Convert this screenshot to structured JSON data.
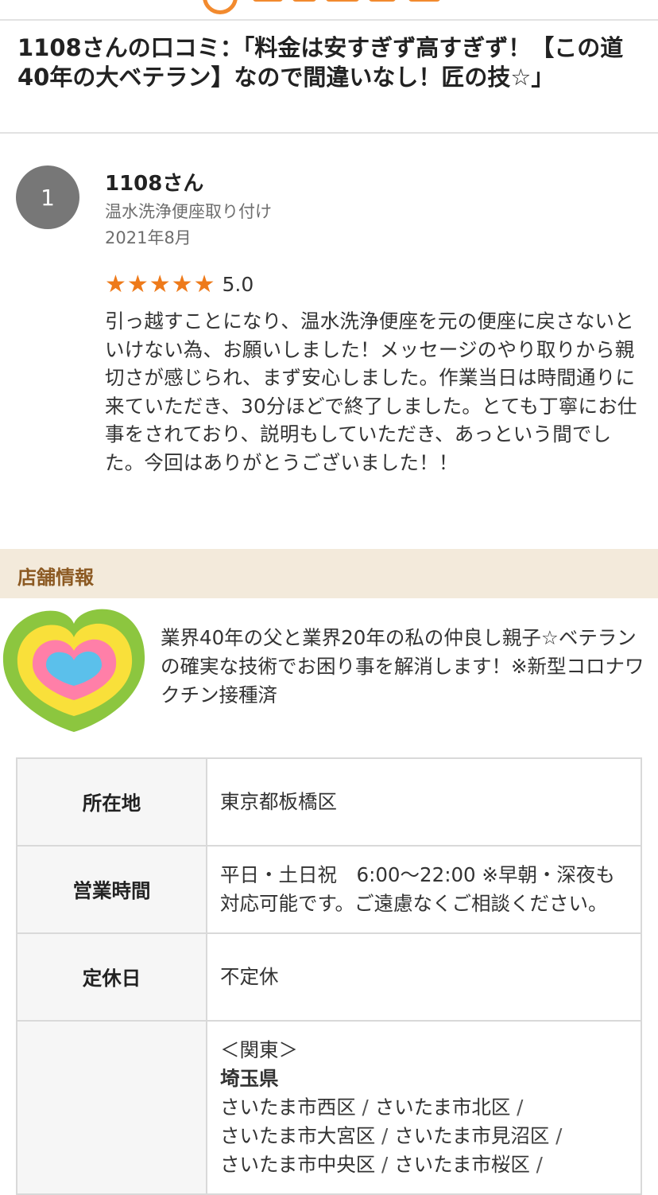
{
  "header": {
    "title": "1108さんの口コミ：「料金は安すぎず高すぎず！【この道40年の大ベテラン】なので間違いなし！匠の技☆」"
  },
  "review": {
    "avatar_text": "1",
    "username": "1108さん",
    "service": "温水洗浄便座取り付け",
    "date": "2021年8月",
    "rating": 5.0,
    "stars": "★★★★★",
    "score_text": "5.0",
    "body": "引っ越すことになり、温水洗浄便座を元の便座に戻さないといけない為、お願いしました！メッセージのやり取りから親切さが感じられ、まず安心しました。作業当日は時間通りに来ていただき、30分ほどで終了しました。とても丁寧にお仕事をされており、説明もしていただき、あっという間でした。今回はありがとうございました！！"
  },
  "shop": {
    "section_title": "店舗情報",
    "description": "業界40年の父と業界20年の私の仲良し親子☆ベテランの確実な技術でお困り事を解消します！※新型コロナワクチン接種済",
    "info": {
      "location_label": "所在地",
      "location_value": "東京都板橋区",
      "hours_label": "営業時間",
      "hours_value": "平日・土日祝　6:00〜22:00 ※早朝・深夜も対応可能です。ご遠慮なくご相談ください。",
      "holiday_label": "定休日",
      "holiday_value": "不定休",
      "area_region": "＜関東＞",
      "area_prefecture": "埼玉県",
      "area_cities": [
        "さいたま市西区",
        "さいたま市北区",
        "さいたま市大宮区",
        "さいたま市見沼区",
        "さいたま市中央区",
        "さいたま市桜区"
      ]
    }
  },
  "colors": {
    "accent_orange": "#ee7a1a",
    "section_bg": "#f3eadb",
    "section_text": "#8c5a23",
    "avatar_bg": "#777777"
  }
}
